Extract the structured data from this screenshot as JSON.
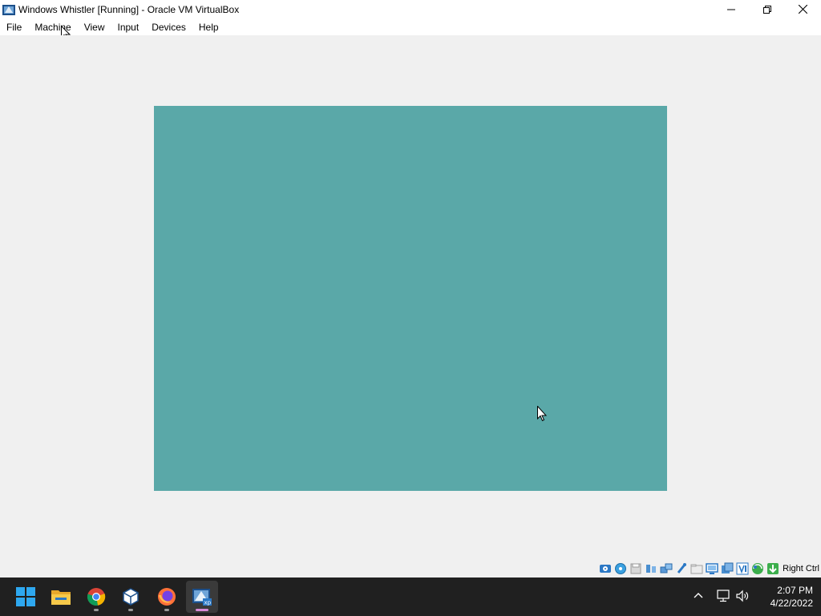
{
  "window": {
    "title": "Windows Whistler [Running] - Oracle VM VirtualBox",
    "icon": "virtualbox-vm-icon",
    "controls": [
      "minimize-icon",
      "restore-icon",
      "close-icon"
    ]
  },
  "menubar": {
    "items": [
      {
        "label": "File"
      },
      {
        "label": "Machine"
      },
      {
        "label": "View"
      },
      {
        "label": "Input"
      },
      {
        "label": "Devices"
      },
      {
        "label": "Help"
      }
    ]
  },
  "guest": {
    "background_color": "#5aa8a8",
    "resolution": "640x480"
  },
  "statusbar": {
    "icons": [
      "hard-disk-icon",
      "optical-drive-icon",
      "floppy-icon",
      "audio-icon",
      "network-icon",
      "usb-icon",
      "shared-folders-icon",
      "display-icon",
      "recording-icon",
      "vt-x-icon",
      "mouse-integration-icon",
      "keyboard-capture-icon"
    ],
    "host_key": "Right Ctrl"
  },
  "taskbar": {
    "apps": [
      {
        "name": "start-icon",
        "running": false
      },
      {
        "name": "file-explorer-icon",
        "running": false
      },
      {
        "name": "chrome-icon",
        "running": true
      },
      {
        "name": "virtualbox-icon",
        "running": true
      },
      {
        "name": "firefox-icon",
        "running": true
      },
      {
        "name": "virtualbox-vm-xp-icon",
        "running": true,
        "active": true
      }
    ],
    "clock": {
      "time": "2:07 PM",
      "date": "4/22/2022"
    }
  },
  "colors": {
    "guest_desktop": "#5aa8a8",
    "taskbar": "#202020",
    "window_bg": "#f0f0f0"
  }
}
